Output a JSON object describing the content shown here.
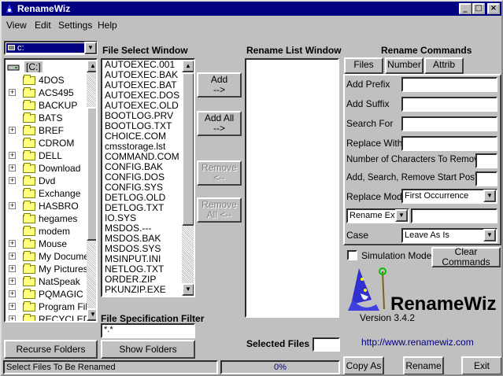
{
  "window": {
    "title": "RenameWiz"
  },
  "menu": [
    "View",
    "Edit",
    "Settings",
    "Help"
  ],
  "drive": {
    "value": "c:"
  },
  "tree": {
    "root": "[C:]",
    "items": [
      {
        "label": "4DOS",
        "exp": false
      },
      {
        "label": "ACS495",
        "exp": true
      },
      {
        "label": "BACKUP",
        "exp": false
      },
      {
        "label": "BATS",
        "exp": false
      },
      {
        "label": "BREF",
        "exp": true
      },
      {
        "label": "CDROM",
        "exp": false
      },
      {
        "label": "DELL",
        "exp": true
      },
      {
        "label": "Download",
        "exp": true
      },
      {
        "label": "Dvd",
        "exp": true
      },
      {
        "label": "Exchange",
        "exp": false
      },
      {
        "label": "HASBRO",
        "exp": true
      },
      {
        "label": "hegames",
        "exp": false
      },
      {
        "label": "modem",
        "exp": false
      },
      {
        "label": "Mouse",
        "exp": true
      },
      {
        "label": "My Documen",
        "exp": true
      },
      {
        "label": "My Pictures",
        "exp": true
      },
      {
        "label": "NatSpeak",
        "exp": true
      },
      {
        "label": "PQMAGIC",
        "exp": true
      },
      {
        "label": "Program Files",
        "exp": true
      },
      {
        "label": "RECYCLED",
        "exp": true
      }
    ]
  },
  "fileSelect": {
    "header": "File Select Window",
    "files": [
      "AUTOEXEC.001",
      "AUTOEXEC.BAK",
      "AUTOEXEC.BAT",
      "AUTOEXEC.DOS",
      "AUTOEXEC.OLD",
      "BOOTLOG.PRV",
      "BOOTLOG.TXT",
      "CHOICE.COM",
      "cmsstorage.lst",
      "COMMAND.COM",
      "CONFIG.BAK",
      "CONFIG.DOS",
      "CONFIG.SYS",
      "DETLOG.OLD",
      "DETLOG.TXT",
      "IO.SYS",
      "MSDOS.---",
      "MSDOS.BAK",
      "MSDOS.SYS",
      "MSINPUT.INI",
      "NETLOG.TXT",
      "ORDER.ZIP",
      "PKUNZIP.EXE"
    ]
  },
  "filter": {
    "label": "File Specification Filter",
    "value": "*.*"
  },
  "midButtons": {
    "add": "Add\n-->",
    "addAll": "Add All\n-->",
    "remove": "Remove\n<--",
    "removeAll": "Remove\nAll <--"
  },
  "renameList": {
    "header": "Rename List Window"
  },
  "selectedFiles": {
    "label": "Selected Files",
    "value": ""
  },
  "commands": {
    "header": "Rename Commands",
    "tabs": [
      "Files",
      "Number",
      "Attrib"
    ],
    "addPrefix": "Add Prefix",
    "addSuffix": "Add Suffix",
    "searchFor": "Search For",
    "replaceWith": "Replace With",
    "numChars": "Number of Characters To Remove",
    "startPos": "Add, Search, Remove Start Pos'n",
    "replaceMode": "Replace Mode",
    "replaceModeValue": "First Occurrence",
    "renameExt": "Rename Ext.",
    "case": "Case",
    "caseValue": "Leave As Is",
    "simulation": "Simulation Mode",
    "clear": "Clear Commands"
  },
  "brand": {
    "name": "RenameWiz",
    "version": "Version 3.4.2",
    "url": "http://www.renamewiz.com"
  },
  "bottom": {
    "recurse": "Recurse Folders",
    "showFolders": "Show Folders",
    "copyAs": "Copy As",
    "rename": "Rename",
    "exit": "Exit",
    "status": "Select Files To Be Renamed",
    "progress": "0%"
  },
  "colors": {
    "titlebar": "#000080",
    "link": "#000080"
  }
}
